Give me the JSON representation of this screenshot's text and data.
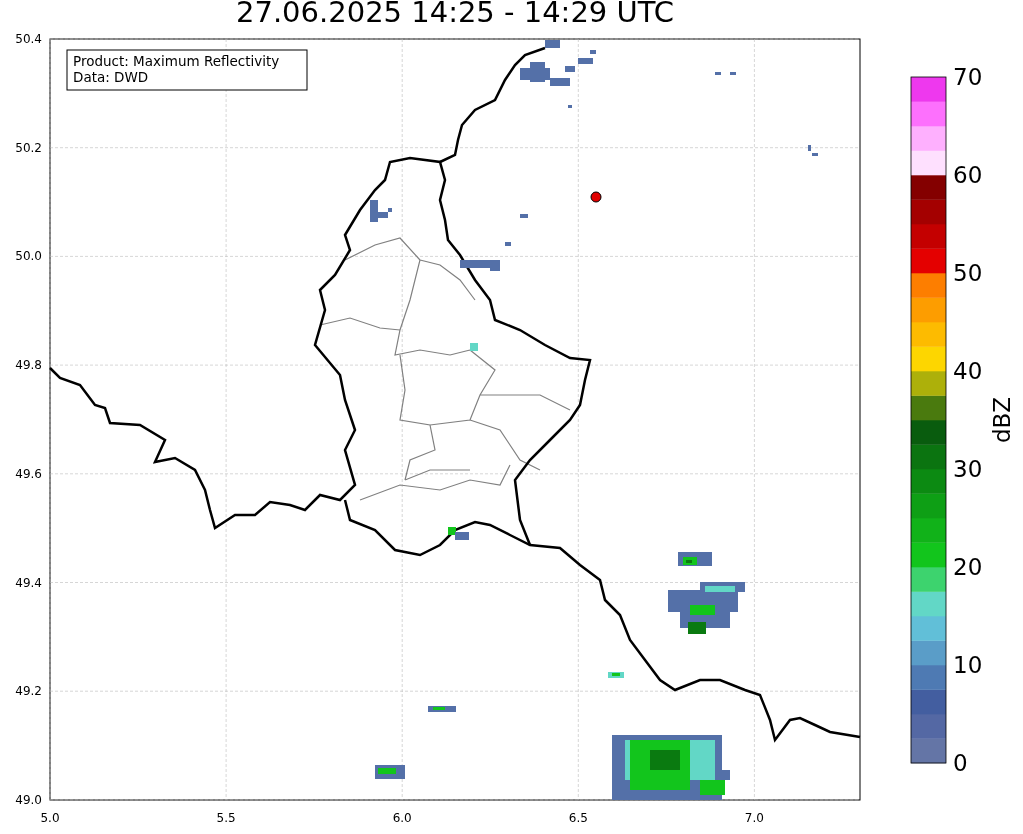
{
  "title": "27.06.2025 14:25 - 14:29 UTC",
  "legend": [
    "Product: Maximum Reflectivity",
    "Data: DWD"
  ],
  "x_ticks": [
    "5.0",
    "5.5",
    "6.0",
    "6.5",
    "7.0"
  ],
  "y_ticks": [
    "50.4",
    "50.2",
    "50.0",
    "49.8",
    "49.6",
    "49.4",
    "49.2",
    "49.0"
  ],
  "colorbar": {
    "label": "dBZ",
    "ticks": [
      "70",
      "60",
      "50",
      "40",
      "30",
      "20",
      "10",
      "0"
    ],
    "segments": [
      {
        "color": "#6475a6"
      },
      {
        "color": "#5468a4"
      },
      {
        "color": "#435ea0"
      },
      {
        "color": "#4e7ab3"
      },
      {
        "color": "#5a9dc8"
      },
      {
        "color": "#61bfd8"
      },
      {
        "color": "#62d7c6"
      },
      {
        "color": "#3dd36e"
      },
      {
        "color": "#12c51c"
      },
      {
        "color": "#11b219"
      },
      {
        "color": "#0e9f15"
      },
      {
        "color": "#0c8a12"
      },
      {
        "color": "#0b7410"
      },
      {
        "color": "#095c0e"
      },
      {
        "color": "#4a7a0e"
      },
      {
        "color": "#adb00a"
      },
      {
        "color": "#fdd600"
      },
      {
        "color": "#fdbb00"
      },
      {
        "color": "#fd9d00"
      },
      {
        "color": "#fd7e00"
      },
      {
        "color": "#e40000"
      },
      {
        "color": "#c40000"
      },
      {
        "color": "#a40000"
      },
      {
        "color": "#840000"
      },
      {
        "color": "#fee0fe"
      },
      {
        "color": "#feb0fe"
      },
      {
        "color": "#fd70fd"
      },
      {
        "color": "#ee38ee"
      }
    ]
  }
}
